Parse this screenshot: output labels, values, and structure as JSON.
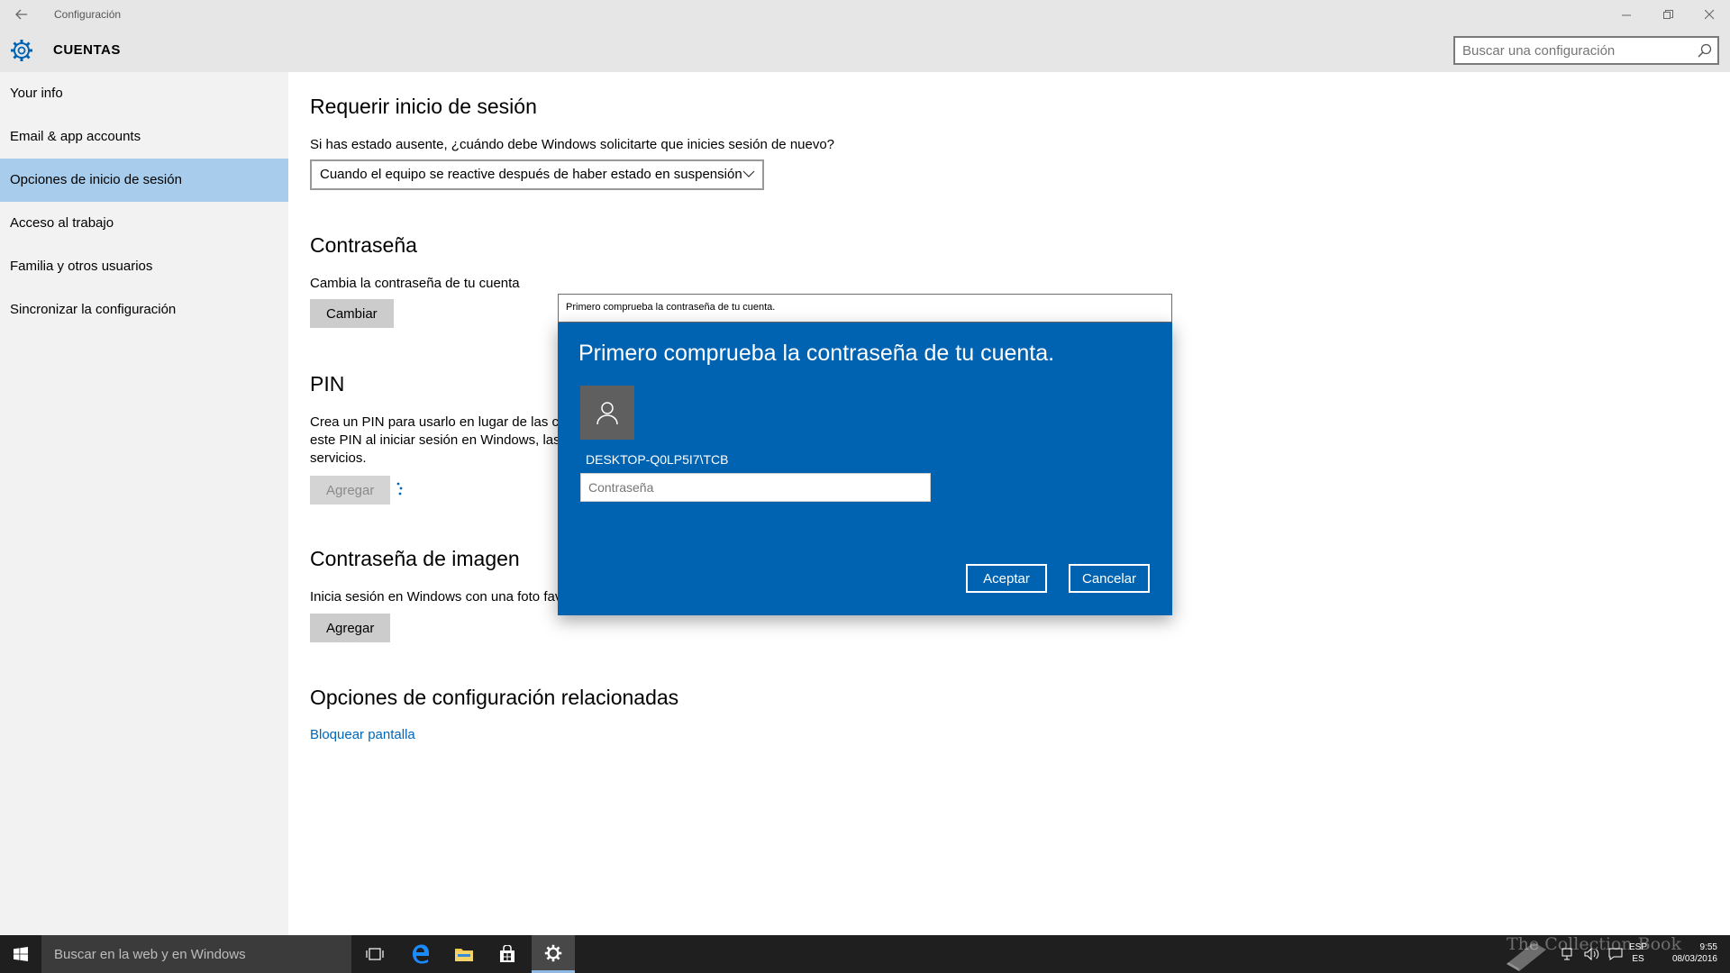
{
  "window": {
    "app_title": "Configuración",
    "section_title": "CUENTAS",
    "search_placeholder": "Buscar una configuración"
  },
  "sidebar": {
    "items": [
      {
        "label": "Your info",
        "active": false
      },
      {
        "label": "Email & app accounts",
        "active": false
      },
      {
        "label": "Opciones de inicio de sesión",
        "active": true
      },
      {
        "label": "Acceso al trabajo",
        "active": false
      },
      {
        "label": "Familia y otros usuarios",
        "active": false
      },
      {
        "label": "Sincronizar la configuración",
        "active": false
      }
    ]
  },
  "main": {
    "require_signin": {
      "heading": "Requerir inicio de sesión",
      "question": "Si has estado ausente, ¿cuándo debe Windows solicitarte que inicies sesión de nuevo?",
      "selected_option": "Cuando el equipo se reactive después de haber estado en suspensión"
    },
    "password": {
      "heading": "Contraseña",
      "description": "Cambia la contraseña de tu cuenta",
      "button": "Cambiar"
    },
    "pin": {
      "heading": "PIN",
      "line1": "Crea un PIN para usarlo en lugar de las co",
      "line2": "este PIN al iniciar sesión en Windows, las",
      "line3": "servicios.",
      "button": "Agregar"
    },
    "picture_password": {
      "heading": "Contraseña de imagen",
      "description": "Inicia sesión en Windows con una foto fav",
      "button": "Agregar"
    },
    "related": {
      "heading": "Opciones de configuración relacionadas",
      "link": "Bloquear pantalla"
    }
  },
  "dialog": {
    "window_title": "Primero comprueba la contraseña de tu cuenta.",
    "heading": "Primero comprueba la contraseña de tu cuenta.",
    "user": "DESKTOP-Q0LP5I7\\TCB",
    "password_placeholder": "Contraseña",
    "ok": "Aceptar",
    "cancel": "Cancelar"
  },
  "taskbar": {
    "search_placeholder": "Buscar en la web y en Windows",
    "lang_top": "ESP",
    "lang_bottom": "ES",
    "time": "9:55",
    "date": "08/03/2016"
  },
  "watermark": "The Collection Book",
  "colors": {
    "accent": "#0063b1",
    "sidebar_active": "#a8cdec",
    "link": "#0067b8",
    "taskbar": "#1f1f1f"
  }
}
